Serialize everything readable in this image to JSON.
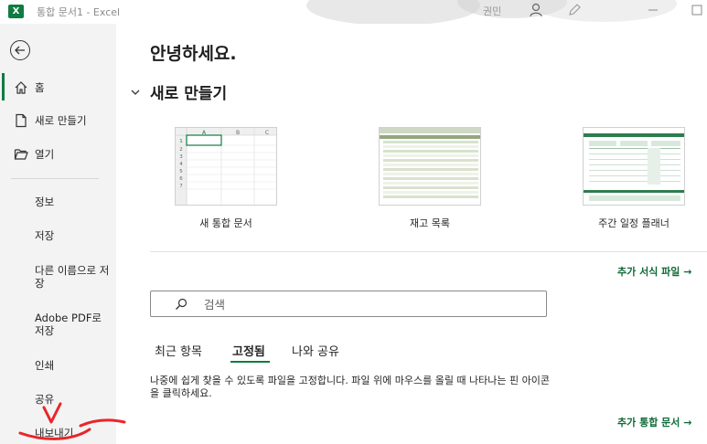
{
  "titlebar": {
    "app_logo": "X",
    "title": "통합 문서1  -  Excel",
    "user": "권민"
  },
  "sidebar": {
    "items": [
      {
        "label": "홈",
        "icon": "home-icon",
        "active": true
      },
      {
        "label": "새로 만들기",
        "icon": "new-file-icon"
      },
      {
        "label": "열기",
        "icon": "folder-open-icon"
      },
      {
        "label": "정보"
      },
      {
        "label": "저장"
      },
      {
        "label": "다른 이름으로 저장"
      },
      {
        "label": "Adobe PDF로 저장"
      },
      {
        "label": "인쇄"
      },
      {
        "label": "공유"
      },
      {
        "label": "내보내기"
      }
    ]
  },
  "main": {
    "greeting": "안녕하세요.",
    "new_section_title": "새로 만들기",
    "templates": [
      {
        "label": "새 통합 문서",
        "thumb_cols": [
          "A",
          "B",
          "C"
        ],
        "thumb_rows": [
          "1",
          "2",
          "3",
          "4",
          "5",
          "6",
          "7"
        ]
      },
      {
        "label": "재고 목록"
      },
      {
        "label": "주간 일정 플래너"
      }
    ],
    "more_templates": "추가 서식 파일  →",
    "search_placeholder": "검색",
    "tabs": [
      {
        "label": "최근 항목"
      },
      {
        "label": "고정됨",
        "active": true
      },
      {
        "label": "나와 공유"
      }
    ],
    "pinned_description": "나중에 쉽게 찾을 수 있도록 파일을 고정합니다. 파일 위에 마우스를 올릴 때 나타나는 핀 아이콘을 클릭하세요.",
    "more_workbooks": "추가 통합 문서  →"
  },
  "colors": {
    "accent": "#107c41",
    "link": "#0f6b38",
    "annotation": "#e8262a"
  }
}
